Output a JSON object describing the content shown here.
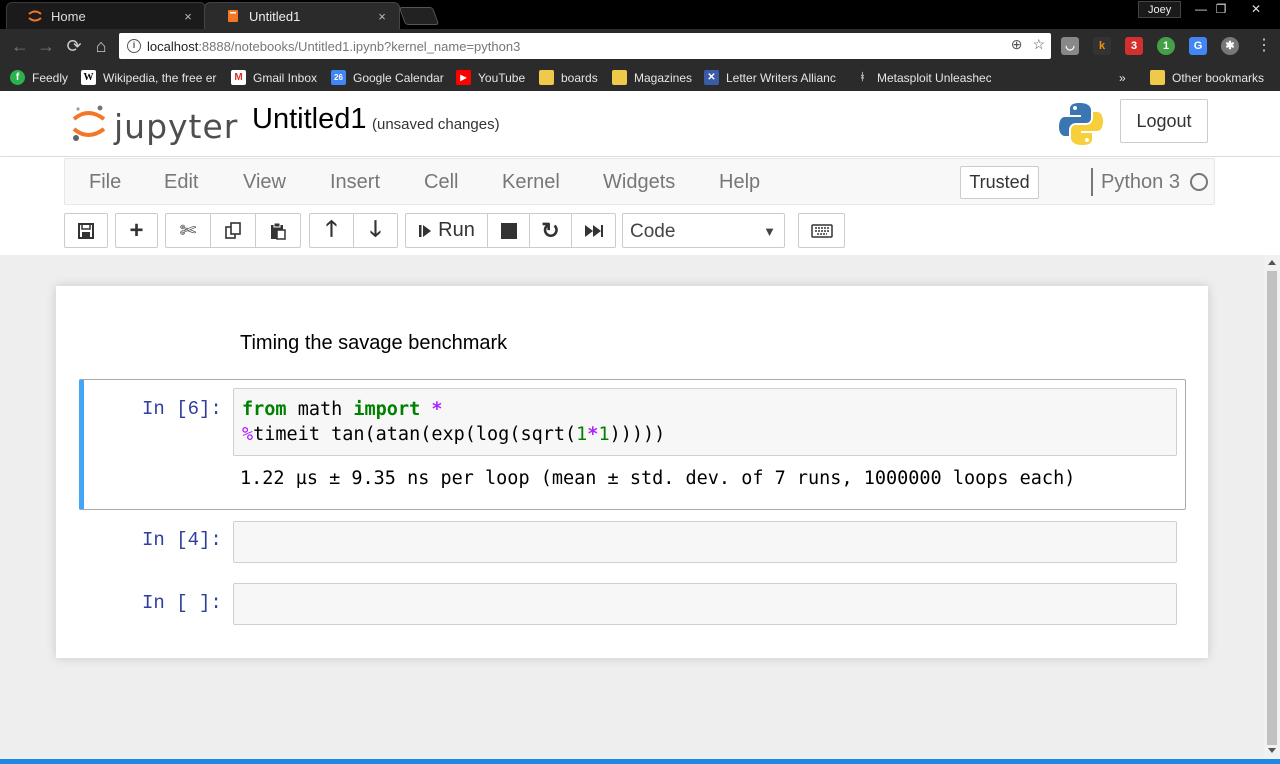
{
  "browser": {
    "tabs": [
      {
        "label": "Home",
        "close": "×",
        "active": false,
        "icon": "jupyter-icon"
      },
      {
        "label": "Untitled1",
        "close": "×",
        "active": true,
        "icon": "notebook-icon"
      }
    ],
    "profile_name": "Joey",
    "window_controls": {
      "minimize": "—",
      "restore": "❐",
      "close": "✕"
    },
    "url_host": "localhost",
    "url_rest": ":8888/notebooks/Untitled1.ipynb?kernel_name=python3",
    "extensions": [
      {
        "label": "k",
        "color": "#f29111"
      },
      {
        "label": "3",
        "color": "#d32f2f"
      },
      {
        "label": "1",
        "color": "#43a047"
      },
      {
        "label": "G",
        "color": "#4285f4"
      }
    ],
    "bookmarks": [
      {
        "label": "Feedly",
        "icon": "feedly-icon",
        "color": "#2bb24c"
      },
      {
        "label": "Wikipedia, the free er",
        "icon": "wikipedia-icon",
        "color": "#fff"
      },
      {
        "label": "Gmail Inbox",
        "icon": "gmail-icon",
        "color": "#d93025"
      },
      {
        "label": "Google Calendar",
        "icon": "calendar-icon",
        "color": "#4285f4"
      },
      {
        "label": "YouTube",
        "icon": "youtube-icon",
        "color": "#ff0000"
      },
      {
        "label": "boards",
        "icon": "folder-icon",
        "color": "#f0c94a"
      },
      {
        "label": "Magazines",
        "icon": "folder-icon",
        "color": "#f0c94a"
      },
      {
        "label": "Letter Writers Allianc",
        "icon": "lwa-icon",
        "color": "#3b5ba9"
      },
      {
        "label": "Metasploit Unleashec",
        "icon": "metasploit-icon",
        "color": "#aaa"
      }
    ],
    "bookmarks_overflow": "»",
    "other_bookmarks": "Other bookmarks"
  },
  "jupyter": {
    "logo_text": "jupyter",
    "notebook_title": "Untitled1",
    "save_status": "(unsaved changes)",
    "logout_label": "Logout",
    "menu": [
      "File",
      "Edit",
      "View",
      "Insert",
      "Cell",
      "Kernel",
      "Widgets",
      "Help"
    ],
    "trusted_label": "Trusted",
    "kernel_name": "Python 3",
    "run_label": "Run",
    "cell_type": "Code",
    "accent_color": "#42a5f5",
    "prompt_color": "#303f9f"
  },
  "cells": {
    "markdown_text": "Timing the savage benchmark",
    "cell1": {
      "prompt": "In [6]:",
      "line1": {
        "kw1": "from",
        "mod": " math ",
        "kw2": "import",
        "sp": " ",
        "star": "*"
      },
      "line2": {
        "magic": "%",
        "cmd": "timeit tan(atan(exp(log(sqrt(",
        "n1": "1",
        "op": "*",
        "n2": "1",
        "close": ")))))"
      },
      "output": "1.22 µs ± 9.35 ns per loop (mean ± std. dev. of 7 runs, 1000000 loops each)"
    },
    "cell2": {
      "prompt": "In [4]:"
    },
    "cell3": {
      "prompt": "In [ ]:"
    }
  }
}
